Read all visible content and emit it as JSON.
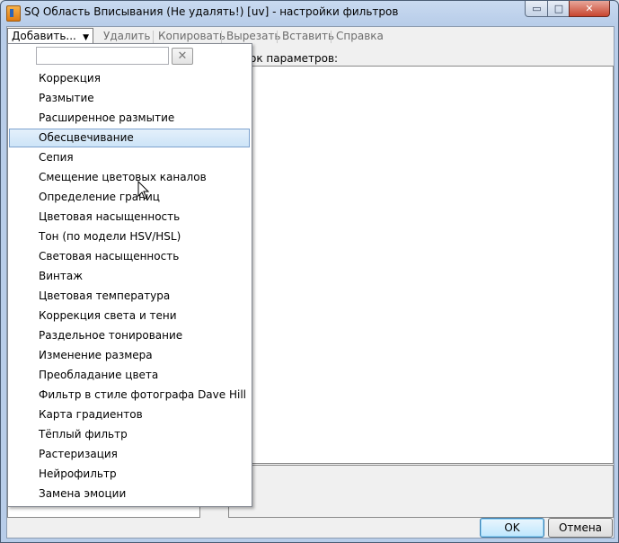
{
  "window": {
    "title": "SQ Область Вписывания (Не удалять!) [uv] - настройки фильтров",
    "min_glyph": "▭",
    "max_glyph": "□",
    "close_glyph": "✕"
  },
  "menubar": {
    "add_label": "Добавить...",
    "items": [
      "Удалить",
      "Копировать",
      "Вырезать",
      "Вставить",
      "Справка"
    ]
  },
  "params_label": "ок параметров:",
  "search": {
    "value": "",
    "clear_glyph": "✕"
  },
  "options": [
    "Коррекция",
    "Размытие",
    "Расширенное размытие",
    "Обесцвечивание",
    "Сепия",
    "Смещение цветовых каналов",
    "Определение границ",
    "Цветовая насыщенность",
    "Тон (по модели HSV/HSL)",
    "Световая насыщенность",
    "Винтаж",
    "Цветовая температура",
    "Коррекция света и тени",
    "Раздельное тонирование",
    "Изменение размера",
    "Преобладание цвета",
    "Фильтр в стиле фотографа Dave Hill",
    "Карта градиентов",
    "Тёплый фильтр",
    "Растеризация",
    "Нейрофильтр",
    "Замена эмоции"
  ],
  "selected_option": "Обесцвечивание",
  "buttons": {
    "ok": "OK",
    "cancel": "Отмена"
  }
}
